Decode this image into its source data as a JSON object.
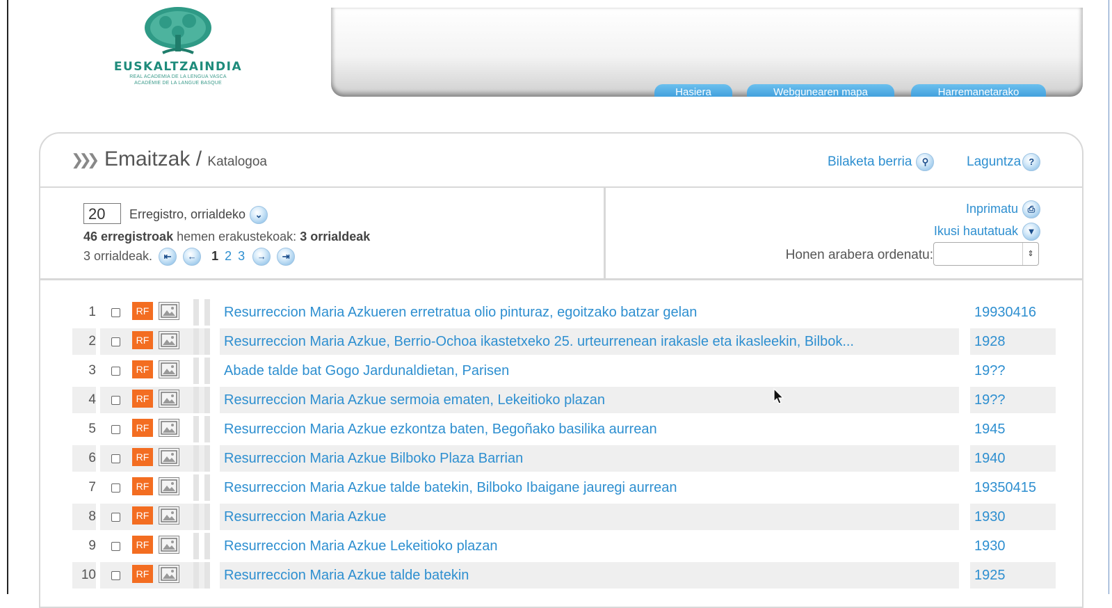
{
  "logo": {
    "name": "EUSKALTZAINDIA",
    "sub1": "REAL ACADEMIA DE LA LENGUA VASCA",
    "sub2": "ACADÉMIE DE LA LANGUE BASQUE"
  },
  "nav": {
    "tabs": [
      {
        "label": "Hasiera"
      },
      {
        "label": "Webgunearen mapa"
      },
      {
        "label": "Harremanetarako"
      }
    ]
  },
  "header": {
    "title": "Emaitzak",
    "separator": "/",
    "subtitle": "Katalogoa",
    "new_search": "Bilaketa berria",
    "help": "Laguntza"
  },
  "controls": {
    "per_page_value": "20",
    "per_page_label": "Erregistro, orrialdeko",
    "records_count": "46 erregistroak",
    "records_mid": " hemen erakustekoak: ",
    "records_pages": "3 orrialdeak",
    "pages_label": "3 orrialdeak.",
    "page_current": "1",
    "page_2": "2",
    "page_3": "3",
    "print": "Inprimatu",
    "view_selected": "Ikusi hautatuak",
    "sort_label": "Honen arabera ordenatu:"
  },
  "rf_label": "RF",
  "rows": [
    {
      "num": "1",
      "title": "Resurreccion Maria Azkueren erretratua olio pinturaz, egoitzako batzar gelan",
      "year": "19930416"
    },
    {
      "num": "2",
      "title": "Resurreccion Maria Azkue, Berrio-Ochoa ikastetxeko 25. urteurrenean irakasle eta ikasleekin, Bilbok...",
      "year": "1928"
    },
    {
      "num": "3",
      "title": "Abade talde bat Gogo Jardunaldietan, Parisen",
      "year": "19??"
    },
    {
      "num": "4",
      "title": "Resurreccion Maria Azkue sermoia ematen, Lekeitioko plazan",
      "year": "19??"
    },
    {
      "num": "5",
      "title": "Resurreccion Maria Azkue ezkontza baten, Begoñako basilika aurrean",
      "year": "1945"
    },
    {
      "num": "6",
      "title": "Resurreccion Maria Azkue Bilboko Plaza Barrian",
      "year": "1940"
    },
    {
      "num": "7",
      "title": "Resurreccion Maria Azkue talde batekin, Bilboko Ibaigane jauregi aurrean",
      "year": "19350415"
    },
    {
      "num": "8",
      "title": "Resurreccion Maria Azkue",
      "year": "1930"
    },
    {
      "num": "9",
      "title": "Resurreccion Maria Azkue Lekeitioko plazan",
      "year": "1930"
    },
    {
      "num": "10",
      "title": "Resurreccion Maria Azkue talde batekin",
      "year": "1925"
    }
  ],
  "colors": {
    "link": "#2e8fd0",
    "rf_badge": "#f36d21",
    "logo_green": "#1e8b7b",
    "nav_tab": "#2b8fd3"
  }
}
